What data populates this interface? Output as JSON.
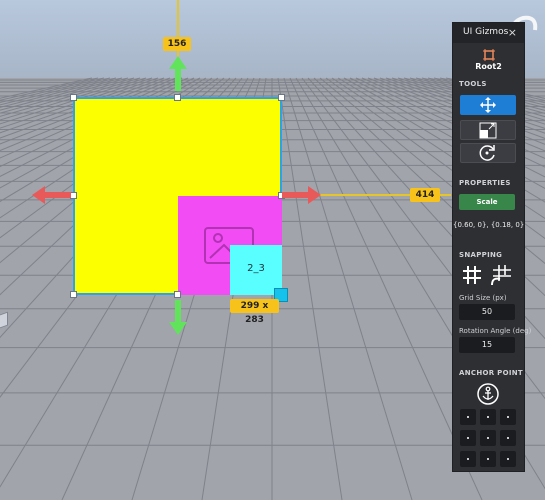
{
  "viewport": {
    "labels": {
      "distance_top": "156",
      "distance_right": "414",
      "size": "299 x 283",
      "frame_name": "2_3"
    },
    "colors": {
      "root_frame": "#fbff00",
      "inner_frame": "#f24cf4",
      "small_frame": "#59ffff",
      "selection": "#2aa3e8",
      "guide_tag": "#f7c31a",
      "move_x_arrow": "#e85a5a",
      "move_y_arrow": "#61e35c"
    }
  },
  "panel": {
    "title": "UI Gizmos",
    "close": "×",
    "selected_object": "Root2",
    "sections": {
      "tools": "TOOLS",
      "properties": "PROPERTIES",
      "snapping": "SNAPPING",
      "anchor_point": "ANCHOR POINT"
    },
    "tools": [
      {
        "icon": "move-icon",
        "active": true
      },
      {
        "icon": "resize-icon",
        "active": false
      },
      {
        "icon": "rotate-icon",
        "active": false
      }
    ],
    "properties": {
      "mode_button": "Scale",
      "value": "{0.60, 0}, {0.18, 0}"
    },
    "snapping": {
      "grid_size_label": "Grid Size (px)",
      "grid_size_value": "50",
      "rotation_label": "Rotation Angle (deg)",
      "rotation_value": "15"
    }
  }
}
